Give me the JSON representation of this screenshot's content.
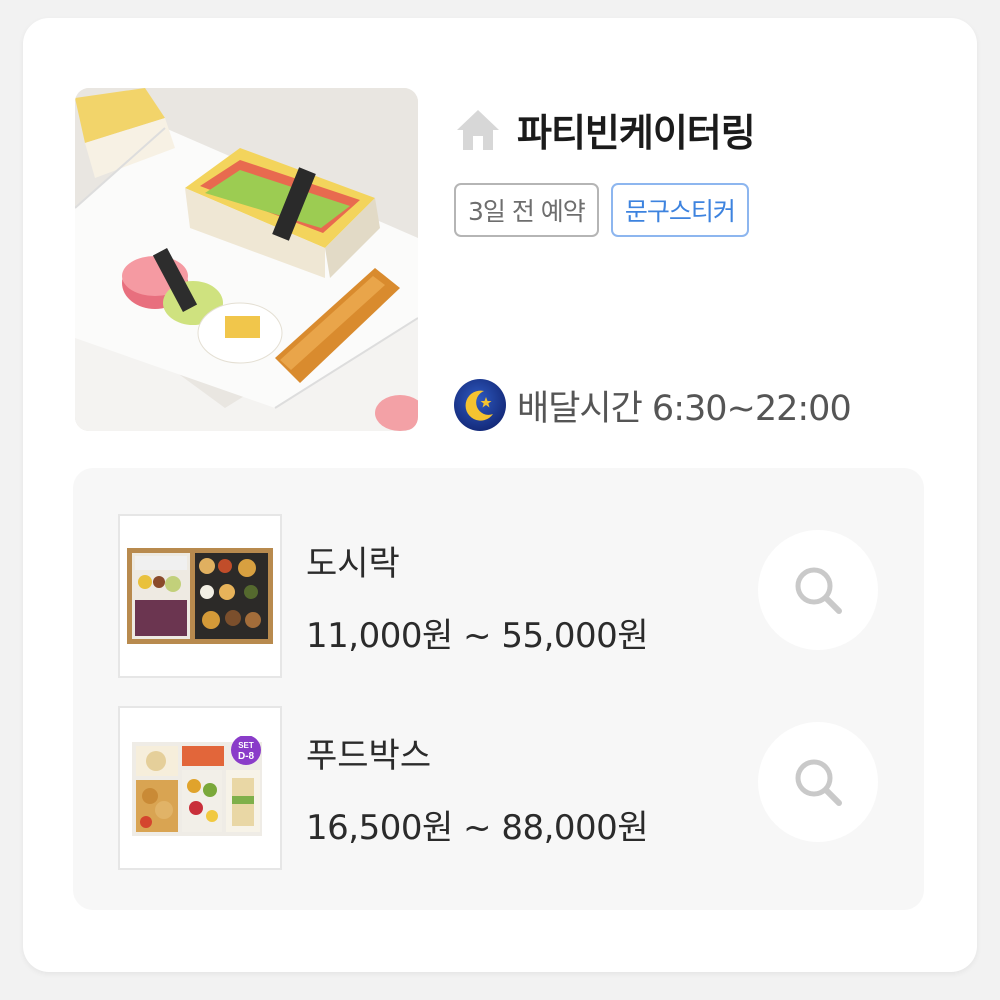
{
  "store": {
    "name": "파티빈케이터링",
    "tags": [
      {
        "label": "3일 전 예약",
        "style": "gray"
      },
      {
        "label": "문구스티커",
        "style": "blue"
      }
    ],
    "delivery": "배달시간 6:30~22:00",
    "icons": {
      "home": "home-icon",
      "delivery": "moon-icon"
    }
  },
  "menus": [
    {
      "name": "도시락",
      "price": "11,000원 ~ 55,000원",
      "search_icon": "search-icon"
    },
    {
      "name": "푸드박스",
      "price": "16,500원 ~ 88,000원",
      "badge_top": "SET",
      "badge_bottom": "D-8",
      "search_icon": "search-icon"
    }
  ],
  "colors": {
    "tag_gray": "#b5b5b5",
    "tag_blue": "#3d83df",
    "moon_bg": "#1f3d9a",
    "moon": "#f5c330",
    "badge": "#8a3cc9"
  }
}
